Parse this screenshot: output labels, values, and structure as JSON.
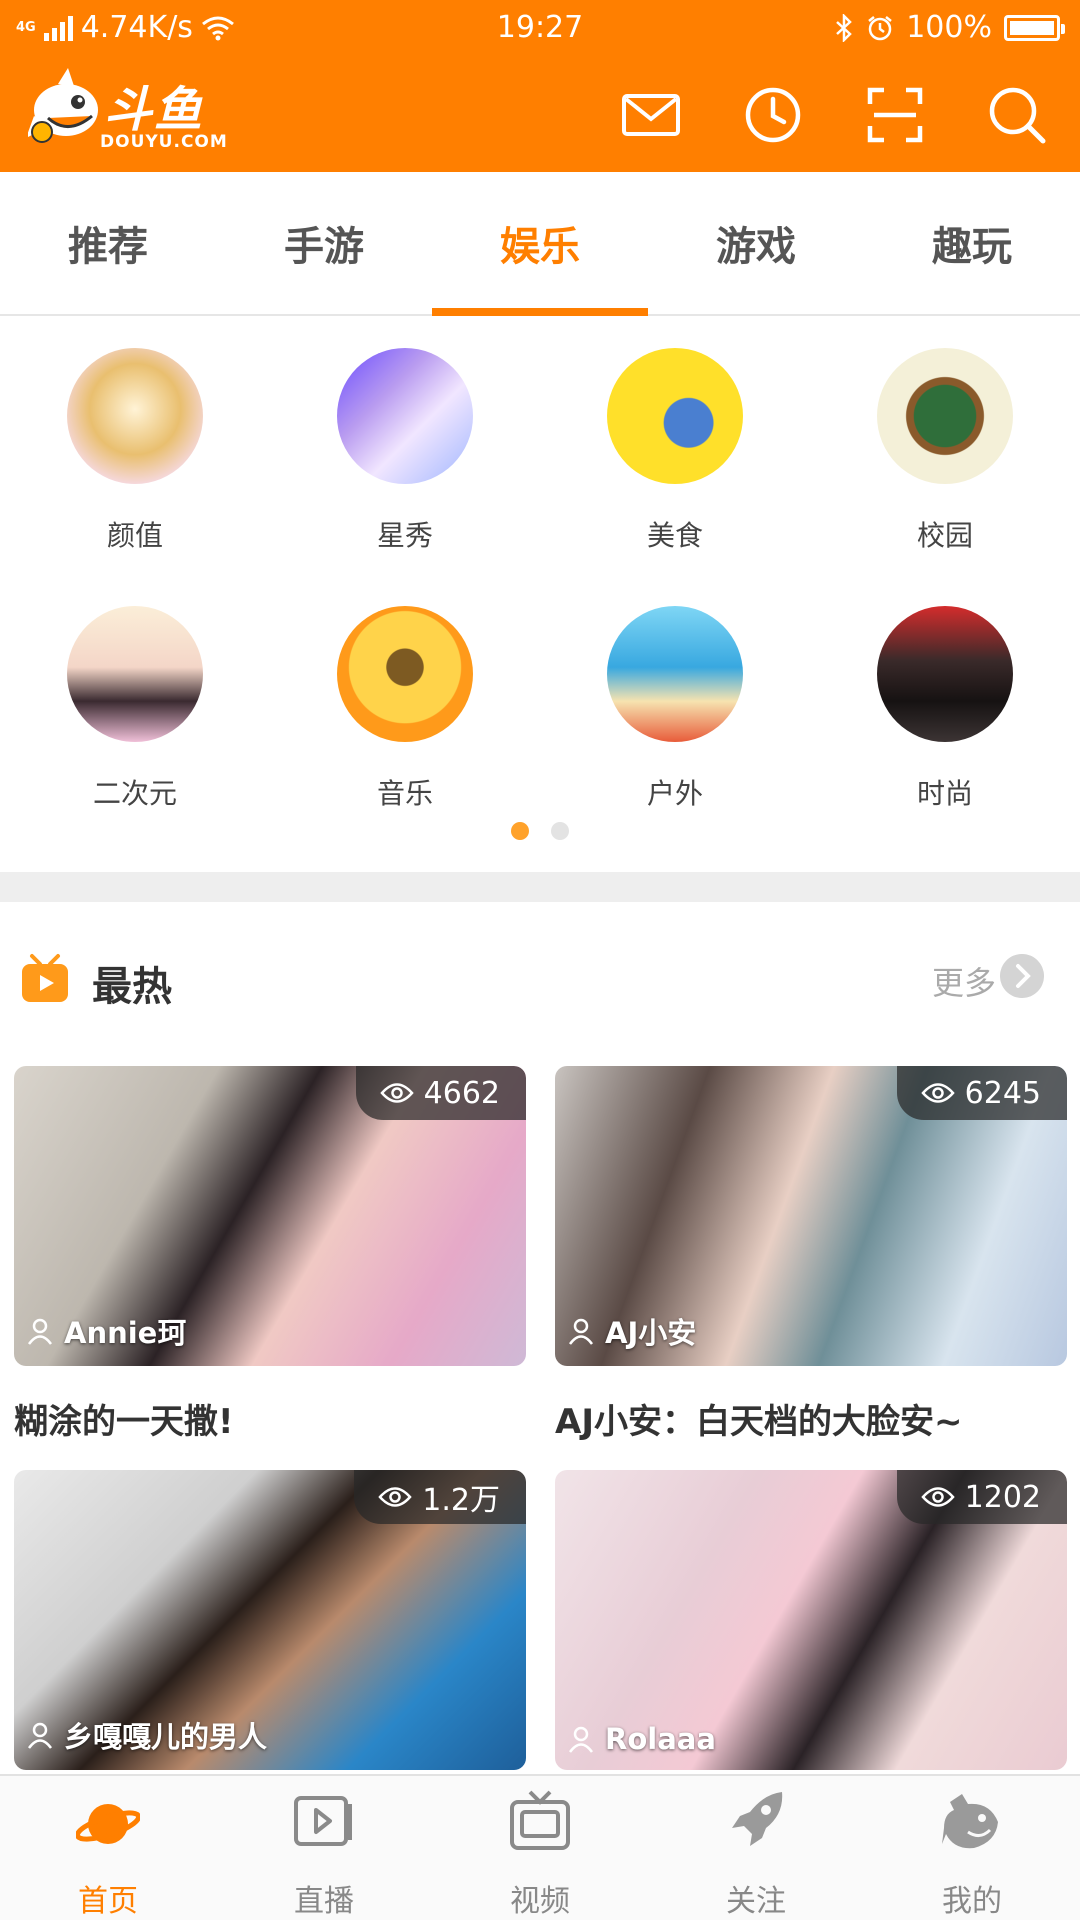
{
  "status_bar": {
    "network": "4G",
    "speed": "4.74K/s",
    "time": "19:27",
    "battery": "100%"
  },
  "header": {
    "logo_text": "斗鱼",
    "logo_sub": "DOUYU.COM",
    "icons": [
      "mail-icon",
      "history-icon",
      "scan-icon",
      "search-icon"
    ],
    "accent_color": "#ff7f00"
  },
  "tabs": [
    {
      "label": "推荐"
    },
    {
      "label": "手游"
    },
    {
      "label": "娱乐"
    },
    {
      "label": "游戏"
    },
    {
      "label": "趣玩"
    }
  ],
  "active_tab": "娱乐",
  "categories": [
    {
      "label": "颜值"
    },
    {
      "label": "星秀"
    },
    {
      "label": "美食"
    },
    {
      "label": "校园"
    },
    {
      "label": "二次元"
    },
    {
      "label": "音乐"
    },
    {
      "label": "户外"
    },
    {
      "label": "时尚"
    }
  ],
  "pager": {
    "pages": 2,
    "current": 1
  },
  "hot": {
    "title": "最热",
    "more": "更多",
    "cards": [
      {
        "viewers": "4662",
        "anchor": "Annie珂",
        "title": "糊涂的一天撒!"
      },
      {
        "viewers": "6245",
        "anchor": "AJ小安",
        "title": "AJ小安：白天档的大脸安~"
      },
      {
        "viewers": "1.2万",
        "anchor": "乡嘎嘎儿的男人",
        "title": ""
      },
      {
        "viewers": "1202",
        "anchor": "Rolaaa",
        "title": ""
      }
    ]
  },
  "bottom_nav": [
    {
      "label": "首页",
      "icon": "planet-icon"
    },
    {
      "label": "直播",
      "icon": "play-icon"
    },
    {
      "label": "视频",
      "icon": "tv-icon"
    },
    {
      "label": "关注",
      "icon": "rocket-icon"
    },
    {
      "label": "我的",
      "icon": "fish-icon"
    }
  ],
  "active_nav": "首页"
}
